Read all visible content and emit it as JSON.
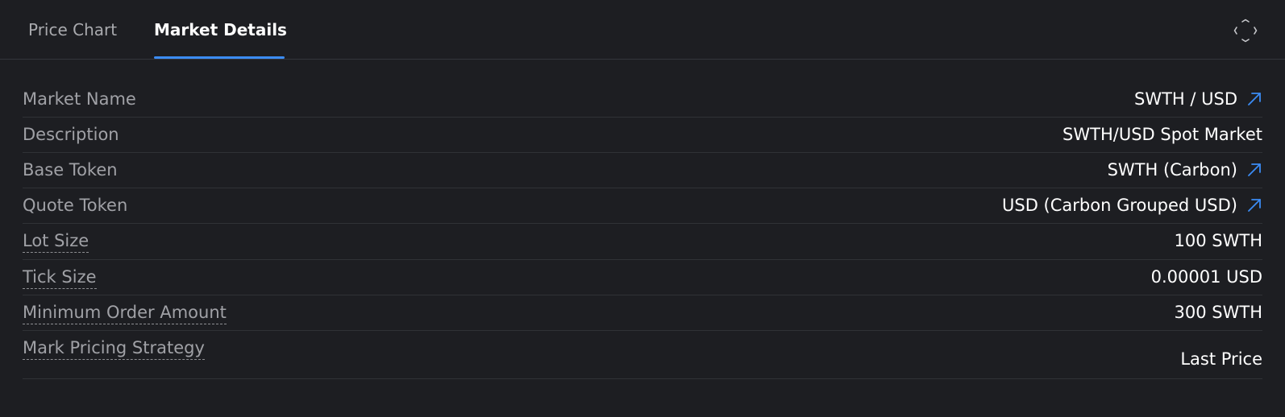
{
  "tabs": [
    {
      "label": "Price Chart",
      "active": false
    },
    {
      "label": "Market Details",
      "active": true
    }
  ],
  "icons": {
    "expand": "expand-corners-icon",
    "external_link": "arrow-up-right-icon"
  },
  "colors": {
    "accent": "#3b8cf5",
    "background": "#1d1e22",
    "label": "#a0a1a6",
    "value": "#ffffff",
    "divider": "#303236"
  },
  "details": [
    {
      "label": "Market Name",
      "value": "SWTH / USD",
      "link": true
    },
    {
      "label": "Description",
      "value": "SWTH/USD Spot Market",
      "link": false
    },
    {
      "label": "Base Token",
      "value": "SWTH (Carbon)",
      "link": true
    },
    {
      "label": "Quote Token",
      "value": "USD (Carbon Grouped USD)",
      "link": true
    },
    {
      "label": "Lot Size",
      "value": "100 SWTH",
      "link": false
    },
    {
      "label": "Tick Size",
      "value": "0.00001 USD",
      "link": false
    },
    {
      "label": "Minimum Order Amount",
      "value": "300 SWTH",
      "link": false
    },
    {
      "label": "Mark Pricing Strategy",
      "value": "Last Price",
      "link": false
    }
  ]
}
